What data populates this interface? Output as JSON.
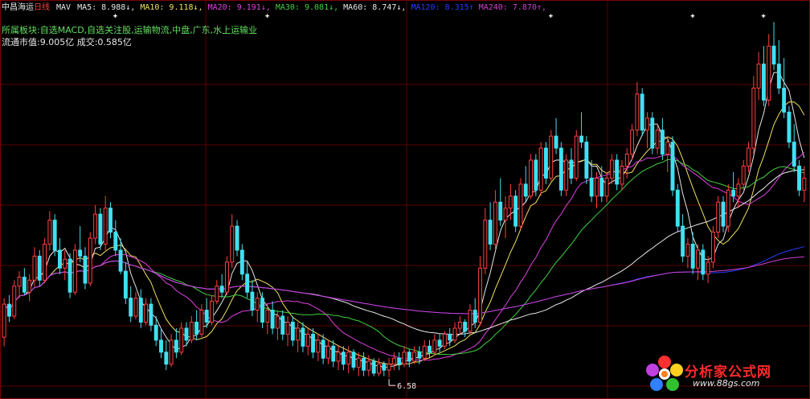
{
  "header": {
    "stock_name": "中昌海运",
    "period": "日线",
    "indicator": "MAV",
    "ma_items": [
      {
        "label": "MA5: 8.988↓,",
        "color": "#e8e8e8"
      },
      {
        "label": "MA10: 9.118↓,",
        "color": "#f0e060"
      },
      {
        "label": "MA20: 9.191↓,",
        "color": "#e040e0"
      },
      {
        "label": "MA30: 9.081↓,",
        "color": "#40d040"
      },
      {
        "label": "MA60: 8.747↓,",
        "color": "#e8e8e8"
      },
      {
        "label": "MA120: 8.315↑",
        "color": "#2a3cff"
      },
      {
        "label": "MA240: 7.870↑,",
        "color": "#d040d0"
      }
    ]
  },
  "info": {
    "sector": "所属板块:自选MACD,自选关注股,运输物流,中盘,广东,水上运输业",
    "cap": "流通市值:9.005亿    成交:0.585亿"
  },
  "annotations": {
    "low_marker": "6.58"
  },
  "watermark": {
    "title": "分析家公式网",
    "url": "www.88gs.com"
  },
  "colors": {
    "up": "#ff4040",
    "down": "#40e0f0",
    "grid": "#5a0000",
    "background": "#000000"
  },
  "chart_data": {
    "type": "candlestick",
    "ylim": [
      6.3,
      12.6
    ],
    "grid": true,
    "low_point": {
      "index": 76,
      "value": 6.58
    },
    "candles": [
      [
        7.25,
        7.9,
        7.1,
        7.8
      ],
      [
        7.8,
        7.95,
        7.5,
        7.6
      ],
      [
        7.6,
        8.2,
        7.55,
        8.1
      ],
      [
        8.1,
        8.35,
        7.9,
        8.25
      ],
      [
        8.25,
        8.4,
        7.95,
        8.0
      ],
      [
        8.0,
        8.3,
        7.85,
        8.2
      ],
      [
        8.2,
        8.75,
        8.1,
        8.6
      ],
      [
        8.6,
        8.7,
        8.1,
        8.2
      ],
      [
        8.2,
        8.9,
        8.15,
        8.8
      ],
      [
        8.8,
        9.35,
        8.7,
        9.2
      ],
      [
        9.2,
        9.3,
        8.6,
        8.7
      ],
      [
        8.7,
        8.9,
        8.3,
        8.4
      ],
      [
        8.4,
        8.7,
        8.2,
        8.55
      ],
      [
        8.55,
        8.65,
        7.9,
        8.0
      ],
      [
        8.0,
        8.8,
        7.95,
        8.7
      ],
      [
        8.7,
        9.1,
        8.5,
        8.6
      ],
      [
        8.6,
        8.75,
        8.05,
        8.15
      ],
      [
        8.15,
        9.0,
        8.1,
        8.9
      ],
      [
        8.9,
        9.45,
        8.8,
        9.3
      ],
      [
        9.3,
        9.4,
        8.7,
        8.8
      ],
      [
        8.8,
        9.6,
        8.7,
        9.4
      ],
      [
        9.4,
        9.5,
        8.9,
        9.0
      ],
      [
        9.0,
        9.2,
        8.6,
        8.7
      ],
      [
        8.7,
        8.9,
        8.3,
        8.35
      ],
      [
        8.35,
        8.5,
        7.8,
        7.9
      ],
      [
        7.9,
        8.1,
        7.5,
        7.6
      ],
      [
        7.6,
        8.0,
        7.55,
        7.9
      ],
      [
        7.9,
        8.05,
        7.4,
        7.5
      ],
      [
        7.5,
        7.9,
        7.45,
        7.8
      ],
      [
        7.8,
        7.9,
        7.35,
        7.45
      ],
      [
        7.45,
        7.6,
        7.1,
        7.2
      ],
      [
        7.2,
        7.4,
        6.9,
        7.0
      ],
      [
        7.0,
        7.2,
        6.7,
        6.8
      ],
      [
        6.8,
        7.3,
        6.75,
        7.2
      ],
      [
        7.2,
        7.4,
        6.9,
        7.0
      ],
      [
        7.0,
        7.5,
        6.95,
        7.4
      ],
      [
        7.4,
        7.5,
        7.1,
        7.2
      ],
      [
        7.2,
        7.6,
        7.15,
        7.5
      ],
      [
        7.5,
        7.7,
        7.2,
        7.3
      ],
      [
        7.3,
        7.8,
        7.25,
        7.7
      ],
      [
        7.7,
        7.9,
        7.4,
        7.5
      ],
      [
        7.5,
        7.95,
        7.45,
        7.85
      ],
      [
        7.85,
        8.2,
        7.8,
        8.1
      ],
      [
        8.1,
        8.3,
        7.9,
        8.0
      ],
      [
        8.0,
        8.6,
        7.95,
        8.5
      ],
      [
        8.5,
        9.3,
        8.4,
        9.1
      ],
      [
        9.1,
        9.2,
        8.6,
        8.7
      ],
      [
        8.7,
        8.8,
        8.2,
        8.3
      ],
      [
        8.3,
        8.5,
        7.9,
        8.0
      ],
      [
        8.0,
        8.2,
        7.6,
        7.7
      ],
      [
        7.7,
        8.0,
        7.5,
        7.9
      ],
      [
        7.9,
        8.0,
        7.4,
        7.5
      ],
      [
        7.5,
        7.8,
        7.3,
        7.7
      ],
      [
        7.7,
        7.85,
        7.3,
        7.4
      ],
      [
        7.4,
        7.7,
        7.2,
        7.6
      ],
      [
        7.6,
        7.7,
        7.2,
        7.3
      ],
      [
        7.3,
        7.6,
        7.1,
        7.5
      ],
      [
        7.5,
        7.6,
        7.1,
        7.2
      ],
      [
        7.2,
        7.5,
        7.0,
        7.4
      ],
      [
        7.4,
        7.5,
        7.0,
        7.1
      ],
      [
        7.1,
        7.4,
        6.95,
        7.3
      ],
      [
        7.3,
        7.4,
        6.9,
        7.0
      ],
      [
        7.0,
        7.3,
        6.85,
        7.2
      ],
      [
        7.2,
        7.3,
        6.8,
        6.9
      ],
      [
        6.9,
        7.2,
        6.8,
        7.1
      ],
      [
        7.1,
        7.2,
        6.75,
        6.85
      ],
      [
        6.85,
        7.1,
        6.7,
        7.0
      ],
      [
        7.0,
        7.1,
        6.7,
        6.8
      ],
      [
        6.8,
        7.1,
        6.65,
        7.0
      ],
      [
        7.0,
        7.05,
        6.7,
        6.75
      ],
      [
        6.75,
        7.0,
        6.6,
        6.9
      ],
      [
        6.9,
        7.0,
        6.6,
        6.7
      ],
      [
        6.7,
        6.95,
        6.6,
        6.85
      ],
      [
        6.85,
        6.9,
        6.6,
        6.65
      ],
      [
        6.65,
        6.9,
        6.6,
        6.8
      ],
      [
        6.8,
        6.85,
        6.6,
        6.7
      ],
      [
        6.7,
        6.9,
        6.58,
        6.8
      ],
      [
        6.8,
        7.0,
        6.7,
        6.9
      ],
      [
        6.9,
        7.0,
        6.7,
        6.8
      ],
      [
        6.8,
        7.1,
        6.75,
        7.0
      ],
      [
        7.0,
        7.05,
        6.75,
        6.85
      ],
      [
        6.85,
        7.1,
        6.8,
        7.0
      ],
      [
        7.0,
        7.1,
        6.8,
        6.9
      ],
      [
        6.9,
        7.2,
        6.85,
        7.1
      ],
      [
        7.1,
        7.2,
        6.9,
        7.0
      ],
      [
        7.0,
        7.3,
        6.95,
        7.2
      ],
      [
        7.2,
        7.3,
        7.0,
        7.1
      ],
      [
        7.1,
        7.35,
        7.05,
        7.3
      ],
      [
        7.3,
        7.4,
        7.1,
        7.2
      ],
      [
        7.2,
        7.5,
        7.15,
        7.4
      ],
      [
        7.4,
        7.6,
        7.3,
        7.5
      ],
      [
        7.5,
        7.55,
        7.25,
        7.35
      ],
      [
        7.35,
        7.8,
        7.3,
        7.7
      ],
      [
        7.7,
        7.9,
        7.4,
        7.5
      ],
      [
        7.5,
        8.6,
        7.45,
        8.4
      ],
      [
        8.4,
        9.4,
        8.3,
        9.2
      ],
      [
        9.2,
        9.5,
        8.7,
        8.8
      ],
      [
        8.8,
        9.7,
        8.7,
        9.5
      ],
      [
        9.5,
        9.9,
        9.1,
        9.2
      ],
      [
        9.2,
        9.6,
        8.9,
        9.4
      ],
      [
        9.4,
        9.8,
        9.2,
        9.6
      ],
      [
        9.6,
        9.7,
        9.0,
        9.1
      ],
      [
        9.1,
        9.9,
        9.05,
        9.8
      ],
      [
        9.8,
        10.1,
        9.5,
        9.6
      ],
      [
        9.6,
        10.3,
        9.55,
        10.2
      ],
      [
        10.2,
        10.3,
        9.6,
        9.7
      ],
      [
        9.7,
        10.5,
        9.6,
        10.4
      ],
      [
        10.4,
        10.5,
        9.8,
        9.9
      ],
      [
        9.9,
        10.7,
        9.85,
        10.6
      ],
      [
        10.6,
        10.9,
        10.3,
        10.4
      ],
      [
        10.4,
        10.5,
        9.6,
        9.7
      ],
      [
        9.7,
        10.3,
        9.6,
        10.2
      ],
      [
        10.2,
        10.4,
        9.8,
        9.9
      ],
      [
        9.9,
        10.7,
        9.85,
        10.6
      ],
      [
        10.6,
        11.0,
        10.4,
        10.5
      ],
      [
        10.5,
        10.6,
        9.8,
        9.9
      ],
      [
        9.9,
        10.2,
        9.5,
        9.6
      ],
      [
        9.6,
        10.0,
        9.4,
        9.9
      ],
      [
        9.9,
        10.1,
        9.5,
        9.6
      ],
      [
        9.6,
        10.0,
        9.5,
        9.9
      ],
      [
        9.9,
        10.3,
        9.8,
        10.2
      ],
      [
        10.2,
        10.3,
        9.7,
        9.8
      ],
      [
        9.8,
        10.2,
        9.7,
        10.1
      ],
      [
        10.1,
        10.4,
        9.9,
        10.3
      ],
      [
        10.3,
        10.8,
        10.2,
        10.7
      ],
      [
        10.7,
        11.5,
        10.6,
        11.3
      ],
      [
        11.3,
        11.4,
        10.6,
        10.7
      ],
      [
        10.7,
        11.0,
        10.4,
        10.9
      ],
      [
        10.9,
        11.0,
        10.3,
        10.4
      ],
      [
        10.4,
        10.8,
        10.3,
        10.7
      ],
      [
        10.7,
        10.9,
        10.2,
        10.3
      ],
      [
        10.3,
        10.6,
        10.0,
        10.5
      ],
      [
        10.5,
        10.6,
        9.6,
        9.7
      ],
      [
        9.7,
        9.8,
        9.0,
        9.1
      ],
      [
        9.1,
        9.3,
        8.5,
        8.6
      ],
      [
        8.6,
        8.9,
        8.4,
        8.8
      ],
      [
        8.8,
        9.0,
        8.3,
        8.4
      ],
      [
        8.4,
        8.8,
        8.2,
        8.7
      ],
      [
        8.7,
        8.8,
        8.2,
        8.3
      ],
      [
        8.3,
        8.6,
        8.15,
        8.5
      ],
      [
        8.5,
        9.1,
        8.4,
        9.0
      ],
      [
        9.0,
        9.6,
        8.9,
        9.5
      ],
      [
        9.5,
        9.6,
        9.0,
        9.1
      ],
      [
        9.1,
        9.8,
        9.0,
        9.7
      ],
      [
        9.7,
        10.0,
        9.5,
        9.6
      ],
      [
        9.6,
        9.9,
        9.4,
        9.8
      ],
      [
        9.8,
        10.2,
        9.7,
        10.1
      ],
      [
        10.1,
        10.5,
        10.0,
        10.4
      ],
      [
        10.4,
        11.6,
        10.3,
        11.4
      ],
      [
        11.4,
        12.0,
        11.2,
        11.8
      ],
      [
        11.8,
        12.1,
        11.1,
        11.2
      ],
      [
        11.2,
        12.3,
        11.1,
        12.1
      ],
      [
        12.1,
        12.5,
        11.7,
        11.8
      ],
      [
        11.8,
        12.2,
        11.3,
        11.4
      ],
      [
        11.4,
        11.9,
        10.9,
        11.0
      ],
      [
        11.0,
        11.1,
        10.4,
        10.5
      ],
      [
        10.5,
        10.8,
        10.0,
        10.1
      ],
      [
        10.1,
        10.2,
        9.6,
        9.7
      ],
      [
        9.7,
        10.1,
        9.5,
        9.9
      ]
    ],
    "series": [
      {
        "name": "MA5",
        "color": "#e8e8e8",
        "period": 5
      },
      {
        "name": "MA10",
        "color": "#f0e060",
        "period": 10
      },
      {
        "name": "MA20",
        "color": "#e040e0",
        "period": 20
      },
      {
        "name": "MA30",
        "color": "#40d040",
        "period": 30
      },
      {
        "name": "MA60",
        "color": "#e8e8e8",
        "period": 60
      },
      {
        "name": "MA120",
        "color": "#2a3cff",
        "period": 120
      },
      {
        "name": "MA240",
        "color": "#d040d0",
        "period": 240
      }
    ]
  }
}
